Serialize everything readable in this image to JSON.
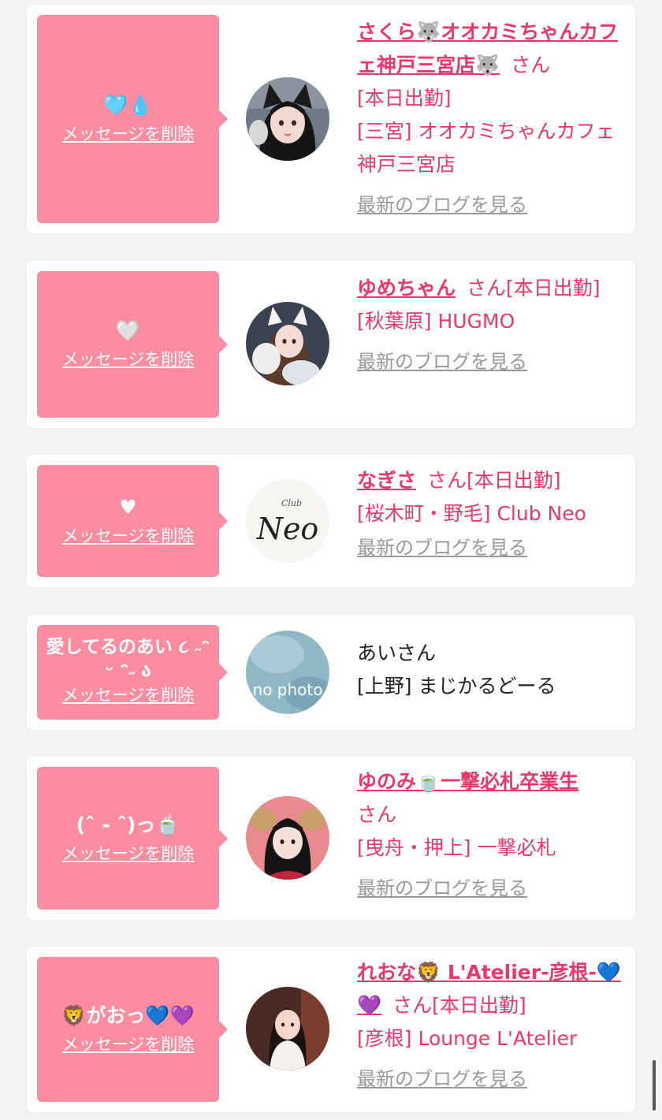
{
  "delete_label": "メッセージを削除",
  "blog_label": "最新のブログを見る",
  "san_suffix": "さん",
  "colors": {
    "pink_bubble": "#fc8da0",
    "name_pink": "#e8386c",
    "card": "#ffffff",
    "page_bg": "#f2f2f2",
    "link_gray": "#999999"
  },
  "items": [
    {
      "message": "🩵💧",
      "name": "さくら🐺オオカミちゃんカフェ神戸三宮店🐺",
      "status": "[本日出勤]",
      "shop": "[三宮] オオカミちゃんカフェ神戸三宮店",
      "avatar_icon": "girl-with-cat-ears-avatar",
      "has_blog": true
    },
    {
      "message": "🤍",
      "name": "ゆめちゃん",
      "status": "[本日出勤]",
      "shop": "[秋葉原] HUGMO",
      "avatar_icon": "girl-with-plush-avatar",
      "has_blog": true
    },
    {
      "message": "♥",
      "name": "なぎさ",
      "status": "[本日出勤]",
      "shop": "[桜木町・野毛] Club Neo",
      "avatar_icon": "club-neo-logo-avatar",
      "avatar_text_small": "Club",
      "avatar_text_big": "Neo",
      "has_blog": true
    },
    {
      "message": "愛してるのあい ૮ ˶ᵔ ᵕ ᵔ˶ ა",
      "name": "あい",
      "status": "",
      "shop": "[上野] まじかるどーる",
      "avatar_icon": "no-photo-avatar",
      "avatar_text": "no photo",
      "has_blog": false
    },
    {
      "message": "(ˆ⁠ ⁠-⁠ ⁠ˆ⁠)っ🍵",
      "name": "ゆのみ🍵一撃必札卒業生",
      "status": "",
      "shop": "[曳舟・押上] 一撃必札",
      "avatar_icon": "girl-with-horns-avatar",
      "has_blog": true
    },
    {
      "message": "🦁がおっ💙💜",
      "name": "れおな🦁 L'Atelier-彦根-💙💜",
      "status": "[本日出勤]",
      "shop": "[彦根] Lounge L'Atelier",
      "avatar_icon": "girl-in-white-dress-avatar",
      "has_blog": true
    }
  ]
}
